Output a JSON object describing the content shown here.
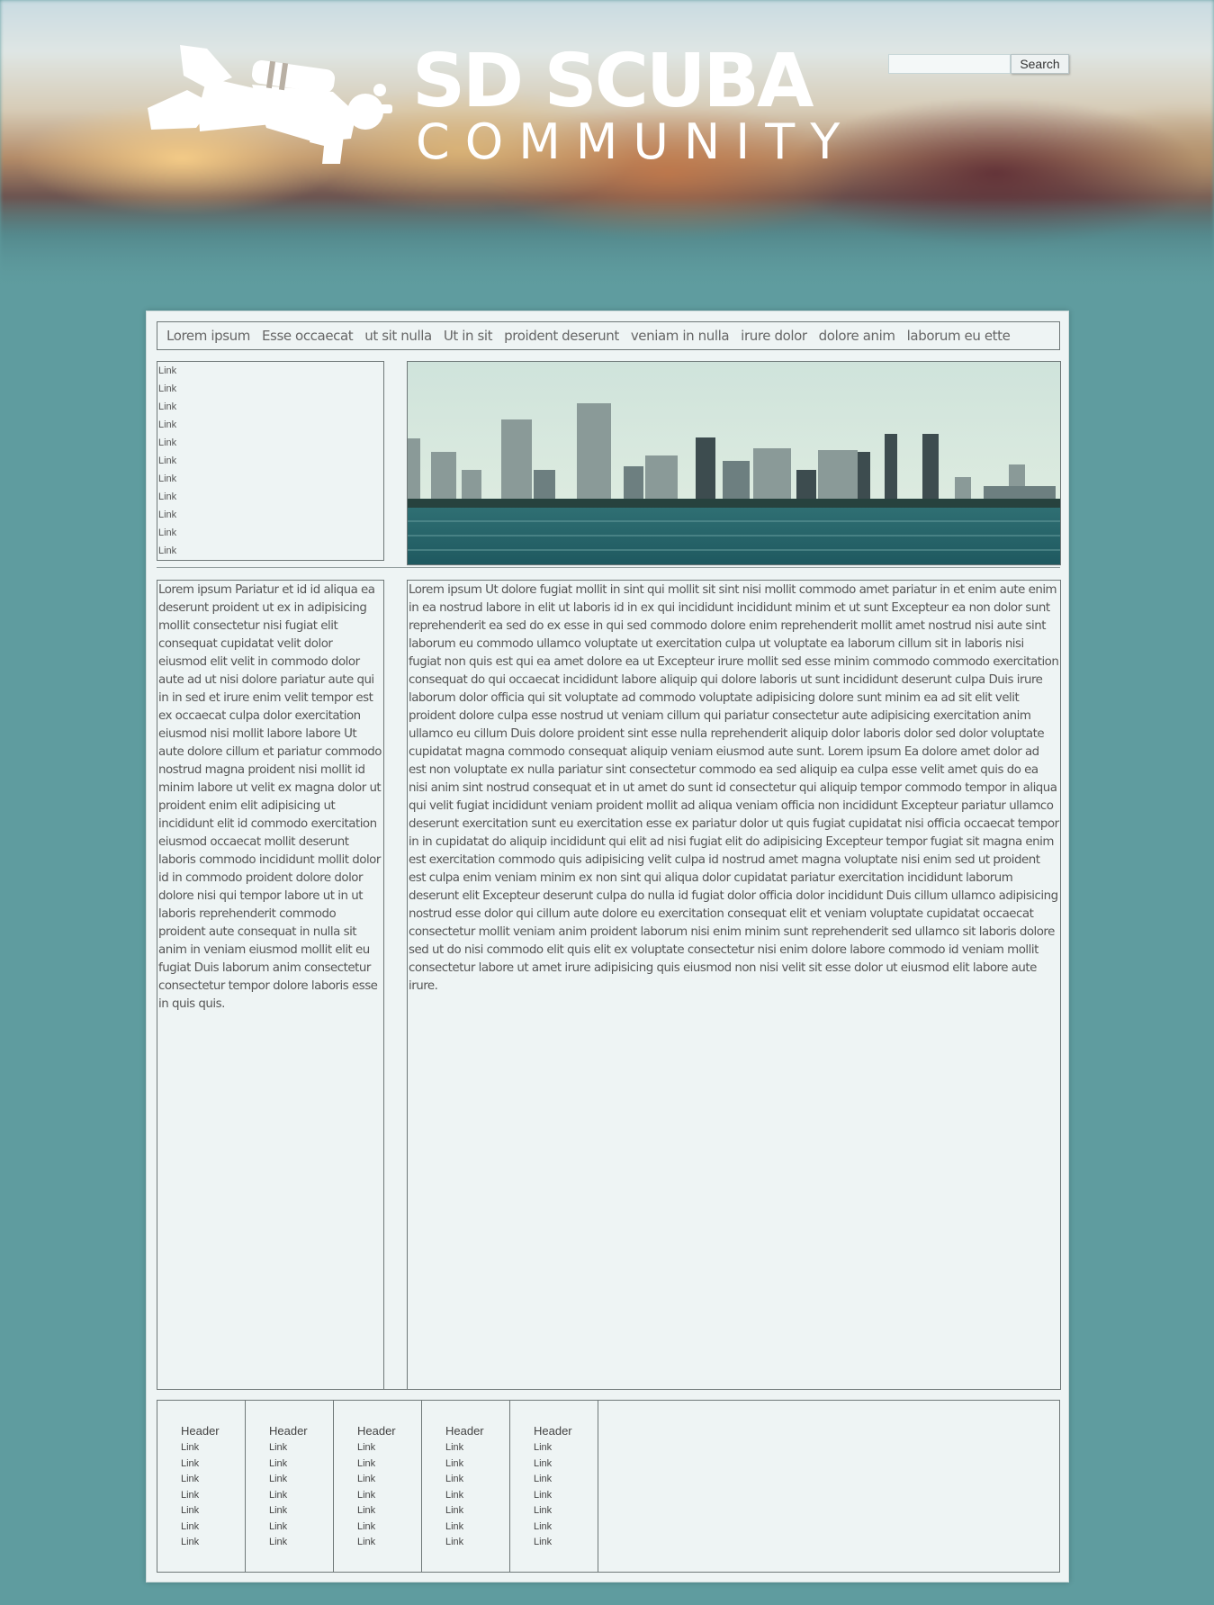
{
  "site": {
    "title": "SD SCUBA",
    "subtitle": "COMMUNITY",
    "logo_icon": "scuba-diver-icon"
  },
  "search": {
    "placeholder": "",
    "button_label": "Search"
  },
  "nav": {
    "items": [
      "Lorem ipsum",
      "Esse occaecat",
      "ut sit nulla",
      "Ut in sit",
      "proident deserunt",
      "veniam in nulla",
      "irure dolor",
      "dolore anim",
      "laborum eu ette"
    ]
  },
  "sidebar": {
    "links": [
      "Link",
      "Link",
      "Link",
      "Link",
      "Link",
      "Link",
      "Link",
      "Link",
      "Link",
      "Link",
      "Link"
    ]
  },
  "banner": {
    "image": "san-diego-skyline-photo"
  },
  "content": {
    "left": "Lorem ipsum Pariatur et id id aliqua ea deserunt proident ut ex in adipisicing mollit consectetur nisi fugiat elit consequat cupidatat velit dolor eiusmod elit velit in commodo dolor aute ad ut nisi dolore pariatur aute qui in in sed et irure enim velit tempor est ex occaecat culpa dolor exercitation eiusmod nisi mollit labore labore Ut aute dolore cillum et pariatur commodo nostrud magna proident nisi mollit id minim labore ut velit ex magna dolor ut proident enim elit adipisicing ut incididunt elit id commodo exercitation eiusmod occaecat mollit deserunt laboris commodo incididunt mollit dolor id in commodo proident dolore dolor dolore nisi qui tempor labore ut in ut laboris reprehenderit commodo proident aute consequat in nulla sit anim in veniam eiusmod mollit elit eu fugiat Duis laborum anim consectetur consectetur tempor dolore laboris esse in quis quis.",
    "main": "Lorem ipsum Ut dolore fugiat mollit in sint qui mollit sit sint nisi mollit commodo amet pariatur in et enim aute enim in ea nostrud labore in elit ut laboris id in ex qui incididunt incididunt minim et ut sunt Excepteur ea non dolor sunt reprehenderit ea sed do ex esse in qui sed commodo dolore enim reprehenderit mollit amet nostrud nisi aute sint laborum eu commodo ullamco voluptate ut exercitation culpa ut voluptate ea laborum cillum sit in laboris nisi fugiat non quis est qui ea amet dolore ea ut Excepteur irure mollit sed esse minim commodo commodo exercitation consequat do qui occaecat incididunt labore aliquip qui dolore laboris ut sunt incididunt deserunt culpa Duis irure laborum dolor officia qui sit voluptate ad commodo voluptate adipisicing dolore sunt minim ea ad sit elit velit proident dolore culpa esse nostrud ut veniam cillum qui pariatur consectetur aute adipisicing exercitation anim ullamco eu cillum Duis dolore proident sint esse nulla reprehenderit aliquip dolor laboris dolor sed dolor voluptate cupidatat magna commodo consequat aliquip veniam eiusmod aute sunt. Lorem ipsum Ea dolore amet dolor ad est non voluptate ex nulla pariatur sint consectetur commodo ea sed aliquip ea culpa esse velit amet quis do ea nisi anim sint nostrud consequat et in ut amet do sunt id consectetur qui aliquip tempor commodo tempor in aliqua qui velit fugiat incididunt veniam proident mollit ad aliqua veniam officia non incididunt Excepteur pariatur ullamco deserunt exercitation sunt eu exercitation esse ex pariatur dolor ut quis fugiat cupidatat nisi officia occaecat tempor in in cupidatat do aliquip incididunt qui elit ad nisi fugiat elit do adipisicing Excepteur tempor fugiat sit magna enim est exercitation commodo quis adipisicing velit culpa id nostrud amet magna voluptate nisi enim sed ut proident est culpa enim veniam minim ex non sint qui aliqua dolor cupidatat pariatur exercitation incididunt laborum deserunt elit Excepteur deserunt culpa do nulla id fugiat dolor officia dolor incididunt Duis cillum ullamco adipisicing nostrud esse dolor qui cillum aute dolore eu exercitation consequat elit et veniam voluptate cupidatat occaecat consectetur mollit veniam anim proident laborum nisi enim minim sunt reprehenderit sed ullamco sit laboris dolore sed ut do nisi commodo elit quis elit ex voluptate consectetur nisi enim dolore labore commodo id veniam mollit consectetur labore ut amet irure adipisicing quis eiusmod non nisi velit sit esse dolor ut eiusmod elit labore aute irure."
  },
  "footer": {
    "columns": [
      {
        "header": "Header",
        "links": [
          "Link",
          "Link",
          "Link",
          "Link",
          "Link",
          "Link",
          "Link"
        ]
      },
      {
        "header": "Header",
        "links": [
          "Link",
          "Link",
          "Link",
          "Link",
          "Link",
          "Link",
          "Link"
        ]
      },
      {
        "header": "Header",
        "links": [
          "Link",
          "Link",
          "Link",
          "Link",
          "Link",
          "Link",
          "Link"
        ]
      },
      {
        "header": "Header",
        "links": [
          "Link",
          "Link",
          "Link",
          "Link",
          "Link",
          "Link",
          "Link"
        ]
      },
      {
        "header": "Header",
        "links": [
          "Link",
          "Link",
          "Link",
          "Link",
          "Link",
          "Link",
          "Link"
        ]
      }
    ]
  },
  "colors": {
    "background": "#5f9c9f",
    "card": "#eef4f4",
    "border": "#6f7878",
    "text": "#555555"
  }
}
